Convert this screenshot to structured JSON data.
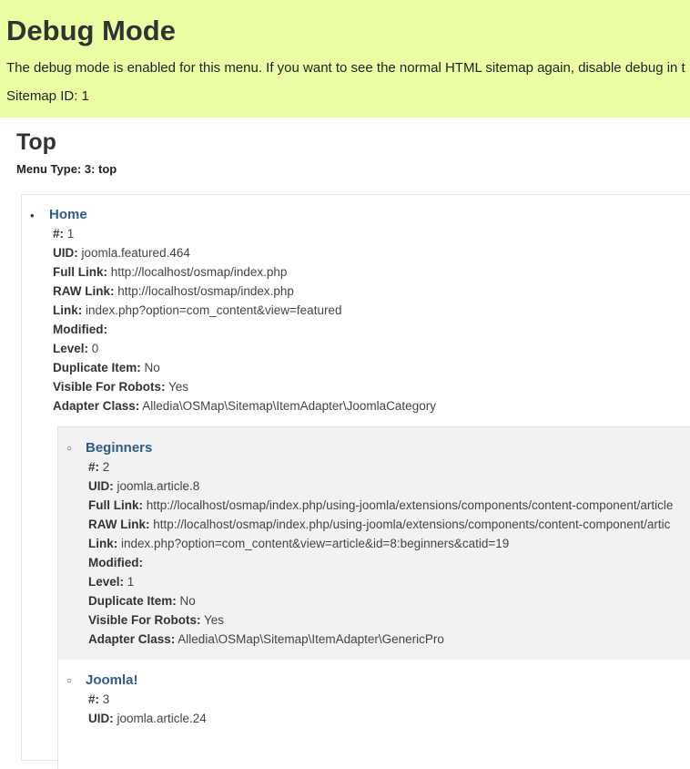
{
  "debug": {
    "title": "Debug Mode",
    "message": "The debug mode is enabled for this menu. If you want to see the normal HTML sitemap again, disable debug in t",
    "sitemap_id": "Sitemap ID: 1"
  },
  "menu": {
    "title": "Top",
    "type_label": "Menu Type: 3: top"
  },
  "labels": {
    "num": "#:",
    "uid": "UID:",
    "full_link": "Full Link:",
    "raw_link": "RAW Link:",
    "link": "Link:",
    "modified": "Modified:",
    "level": "Level:",
    "duplicate": "Duplicate Item:",
    "visible": "Visible For Robots:",
    "adapter": "Adapter Class:"
  },
  "items": [
    {
      "title": "Home",
      "num": "1",
      "uid": "joomla.featured.464",
      "full_link": "http://localhost/osmap/index.php",
      "raw_link": "http://localhost/osmap/index.php",
      "link": "index.php?option=com_content&view=featured",
      "modified": "",
      "level": "0",
      "duplicate": "No",
      "visible": "Yes",
      "adapter": "Alledia\\OSMap\\Sitemap\\ItemAdapter\\JoomlaCategory"
    },
    {
      "title": "Beginners",
      "num": "2",
      "uid": "joomla.article.8",
      "full_link": "http://localhost/osmap/index.php/using-joomla/extensions/components/content-component/article",
      "raw_link": "http://localhost/osmap/index.php/using-joomla/extensions/components/content-component/artic",
      "link": "index.php?option=com_content&view=article&id=8:beginners&catid=19",
      "modified": "",
      "level": "1",
      "duplicate": "No",
      "visible": "Yes",
      "adapter": "Alledia\\OSMap\\Sitemap\\ItemAdapter\\GenericPro"
    },
    {
      "title": "Joomla!",
      "num": "3",
      "uid": "joomla.article.24"
    }
  ],
  "colors": {
    "banner_bg": "#eaffa4",
    "link": "#2f5d8a",
    "nested_bg": "#f2f2f2"
  }
}
